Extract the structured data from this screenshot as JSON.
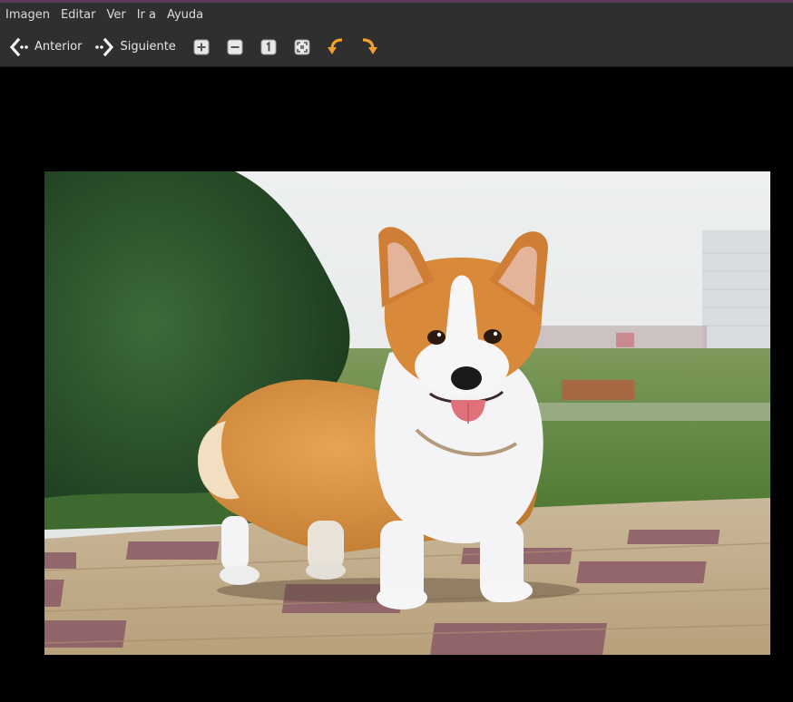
{
  "menubar": {
    "items": [
      {
        "label": "Imagen"
      },
      {
        "label": "Editar"
      },
      {
        "label": "Ver"
      },
      {
        "label": "Ir a"
      },
      {
        "label": "Ayuda"
      }
    ]
  },
  "toolbar": {
    "previous_label": "Anterior",
    "next_label": "Siguiente",
    "icons": [
      "zoom-in-icon",
      "zoom-out-icon",
      "normal-size-icon",
      "best-fit-icon",
      "rotate-left-icon",
      "rotate-right-icon"
    ]
  },
  "colors": {
    "background": "#000000",
    "bar": "#2f2f2f",
    "rotate_accent": "#f0a030",
    "text": "#dcdcdc"
  }
}
